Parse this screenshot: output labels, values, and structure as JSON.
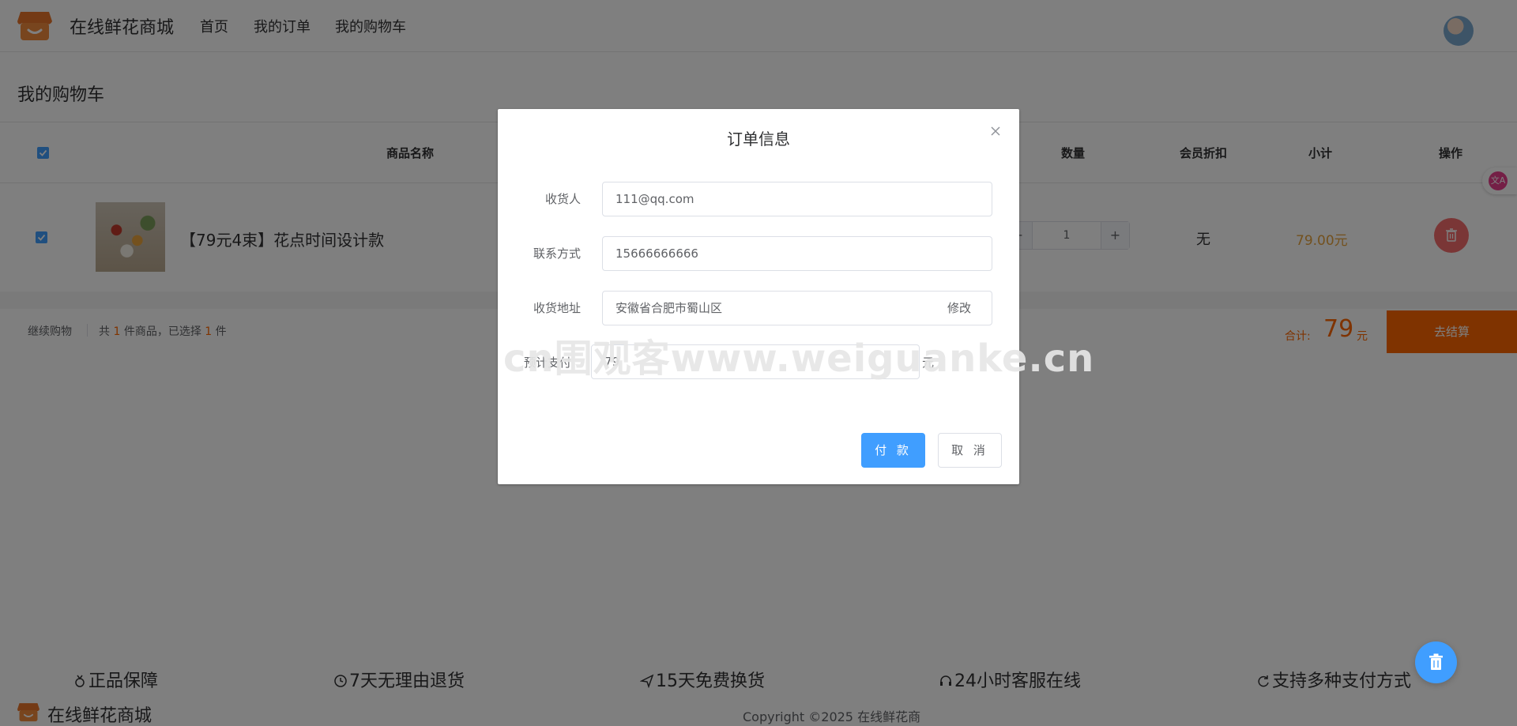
{
  "header": {
    "brand": "在线鲜花商城",
    "nav": [
      "首页",
      "我的订单",
      "我的购物车"
    ]
  },
  "page_title": "我的购物车",
  "table": {
    "headers": {
      "name": "商品名称",
      "quantity": "数量",
      "discount": "会员折扣",
      "subtotal": "小计",
      "action": "操作"
    },
    "rows": [
      {
        "name": "【79元4束】花点时间设计款",
        "quantity": "1",
        "discount": "无",
        "subtotal": "79.00元",
        "checked": true
      }
    ]
  },
  "summary": {
    "continue": "继续购物",
    "total_prefix": "共",
    "total_count": "1",
    "total_mid": "件商品，已选择",
    "selected_count": "1",
    "selected_suffix": "件",
    "total_label": "合计:",
    "total_value": "79",
    "total_unit": "元",
    "checkout": "去结算"
  },
  "footer": {
    "guarantees": [
      "正品保障",
      "7天无理由退货",
      "15天免费换货",
      "24小时客服在线",
      "支持多种支付方式"
    ],
    "brand": "在线鲜花商城",
    "copyright": "Copyright ©2025 在线鲜花商"
  },
  "dialog": {
    "title": "订单信息",
    "receiver_label": "收货人",
    "receiver_value": "111@qq.com",
    "phone_label": "联系方式",
    "phone_value": "15666666666",
    "address_label": "收货地址",
    "address_value": "安徽省合肥市蜀山区",
    "address_modify": "修改",
    "pay_label": "预计支付",
    "pay_value": "79",
    "pay_unit": "元",
    "pay_button": "付 款",
    "cancel_button": "取 消"
  },
  "watermark": "cn围观客www.weiguanke.cn",
  "colors": {
    "primary": "#409eff",
    "accent_orange": "#ff6700",
    "danger": "#f56c6c",
    "overlay": "rgba(0,0,0,0.5)"
  }
}
